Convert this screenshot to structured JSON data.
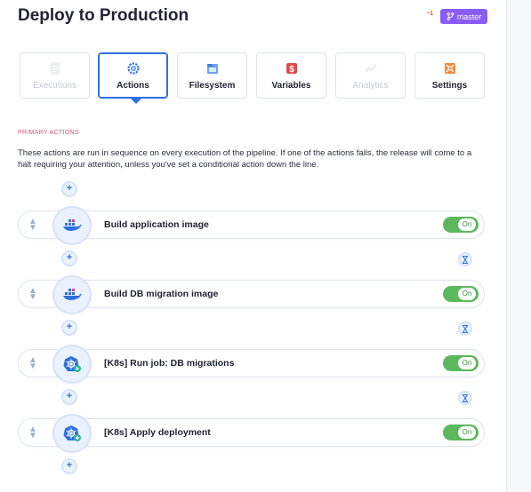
{
  "page": {
    "title": "Deploy to Production"
  },
  "branch": {
    "count": "1",
    "name": "master"
  },
  "tabs": [
    {
      "label": "Executions",
      "state": "disabled",
      "icon": "file-icon"
    },
    {
      "label": "Actions",
      "state": "active",
      "icon": "gear-icon"
    },
    {
      "label": "Filesystem",
      "state": "normal",
      "icon": "folder-icon"
    },
    {
      "label": "Variables",
      "state": "normal",
      "icon": "dollar-icon"
    },
    {
      "label": "Analytics",
      "state": "disabled",
      "icon": "chart-line-icon"
    },
    {
      "label": "Settings",
      "state": "normal",
      "icon": "settings-grid-icon"
    }
  ],
  "primary_actions": {
    "heading": "PRIMARY ACTIONS",
    "description": "These actions are run in sequence on every execution of the pipeline. If one of the actions fails, the release will come to a halt requiring your attention, unless you've set a conditional action down the line.",
    "actions": [
      {
        "name": "Build application image",
        "icon": "docker-icon",
        "toggle": "On"
      },
      {
        "name": "Build DB migration image",
        "icon": "docker-icon",
        "toggle": "On"
      },
      {
        "name": "[K8s] Run job: DB migrations",
        "icon": "kubernetes-run-icon",
        "toggle": "On"
      },
      {
        "name": "[K8s] Apply deployment",
        "icon": "kubernetes-apply-icon",
        "toggle": "On"
      }
    ]
  },
  "colors": {
    "accent": "#2f6fe0",
    "branch_badge": "#8a5cf6",
    "toggle_on": "#5cb85c",
    "section_label": "#e0506b"
  }
}
